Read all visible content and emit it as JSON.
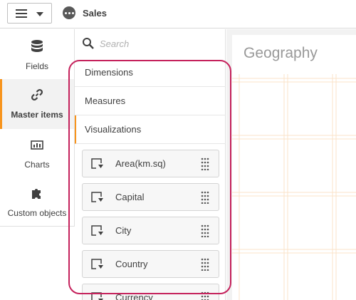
{
  "app": {
    "title": "Sales"
  },
  "nav": {
    "items": [
      {
        "label": "Fields",
        "icon": "database-icon"
      },
      {
        "label": "Master items",
        "icon": "link-icon"
      },
      {
        "label": "Charts",
        "icon": "bar-chart-icon"
      },
      {
        "label": "Custom objects",
        "icon": "puzzle-icon"
      }
    ],
    "active": "Master items"
  },
  "assets": {
    "search_placeholder": "Search",
    "sections": [
      {
        "label": "Dimensions"
      },
      {
        "label": "Measures"
      },
      {
        "label": "Visualizations"
      }
    ],
    "active_section": "Visualizations",
    "items": [
      {
        "label": "Area(km.sq)"
      },
      {
        "label": "Capital"
      },
      {
        "label": "City"
      },
      {
        "label": "Country"
      },
      {
        "label": "Currency"
      }
    ]
  },
  "sheet": {
    "title": "Geography"
  },
  "colors": {
    "accent": "#f7941d",
    "highlight": "#c5225c",
    "grid": "#fbe3c8"
  }
}
